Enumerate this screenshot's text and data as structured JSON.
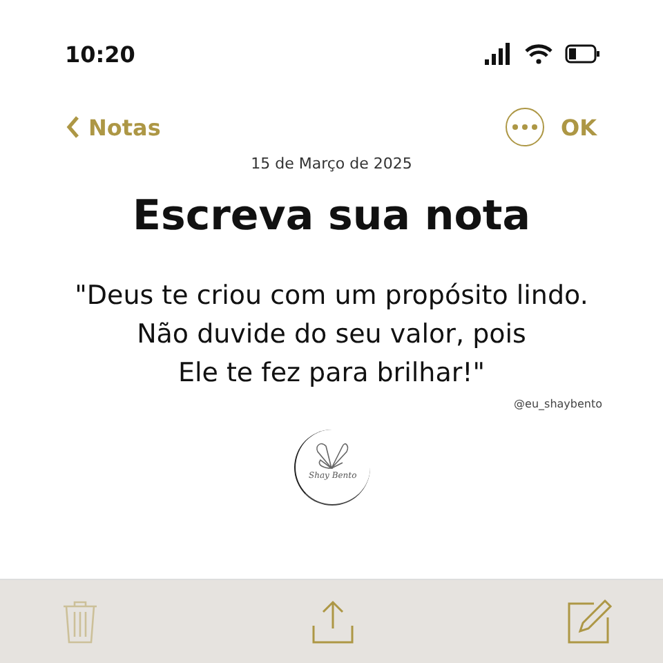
{
  "status_bar": {
    "time": "10:20"
  },
  "nav": {
    "back": "Notas",
    "done": "OK"
  },
  "note": {
    "date": "15 de Março de 2025",
    "title": "Escreva sua nota",
    "quote_lines": [
      "\"Deus te criou com um propósito lindo.",
      "Não duvide do seu valor, pois",
      "Ele te fez para brilhar!\""
    ],
    "handle": "@eu_shaybento",
    "logo_text": "Shay Bento"
  },
  "toolbar": [
    {
      "kind": "delete",
      "disabled": true
    },
    {
      "kind": "share",
      "disabled": false
    },
    {
      "kind": "compose",
      "disabled": false
    }
  ]
}
